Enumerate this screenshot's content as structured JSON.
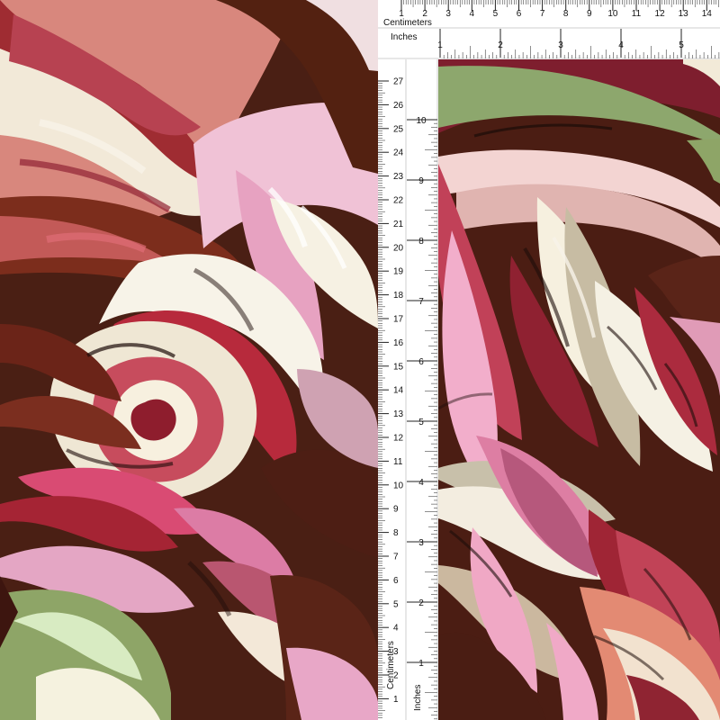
{
  "image": {
    "left_panel": "draped fabric swirl",
    "right_panel": "flat fabric with measurement rulers"
  },
  "rulers": {
    "top": {
      "centimeters_label": "Centimeters",
      "inches_label": "Inches",
      "cm_ticks": [
        "1",
        "2",
        "3",
        "4",
        "5",
        "6",
        "7",
        "8",
        "9",
        "10",
        "11",
        "12",
        "13",
        "14"
      ],
      "inch_ticks": [
        "1",
        "2",
        "3",
        "4",
        "5"
      ]
    },
    "left": {
      "centimeters_label": "Centimeters",
      "inches_label": "Inches",
      "cm_ticks": [
        "27",
        "26",
        "25",
        "24",
        "23",
        "22",
        "21",
        "20",
        "19",
        "18",
        "17",
        "16",
        "15",
        "14",
        "13",
        "12",
        "11",
        "10",
        "9",
        "8",
        "7",
        "6",
        "5",
        "4",
        "3",
        "2",
        "1"
      ],
      "inch_ticks": [
        "10",
        "9",
        "8",
        "7",
        "6",
        "5",
        "4",
        "3",
        "2",
        "1"
      ]
    }
  },
  "colors": {
    "chocolate": "#4b1d13",
    "maroon": "#8f1e2d",
    "pink": "#e6a3c0",
    "blush": "#d7877a",
    "cream": "#f3efdc",
    "sage": "#86a06b",
    "dark": "#1d0d0a"
  }
}
